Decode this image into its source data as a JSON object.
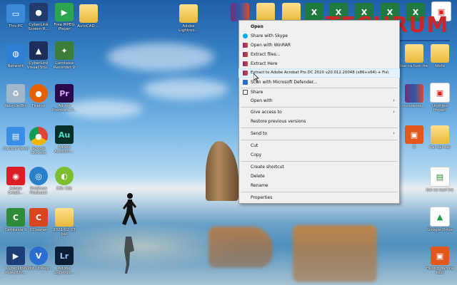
{
  "logo": {
    "text": "TECHRUM"
  },
  "desktop_icons": {
    "thispc": "This PC",
    "screen_recorder": "CyberLink Screen R...",
    "mpeg": "Free MPEG Player",
    "autocad": "AutoCAD ...",
    "adobe_lightroom_top": "Adobe Lightroo...",
    "network": "Network",
    "visual_studio": "CyberLink Visual Stu...",
    "camtasia_recorder": "Camtasia Recorder 9",
    "recycle_bin": "Recycle Bin",
    "firefox": "Firefox",
    "premiere": "Adobe Premiere P...",
    "control_panel": "Control Panel",
    "chrome": "Google Chrome",
    "audition": "Adobe Audition...",
    "adobe_creative": "Adobe Creati...",
    "proshow": "ProShow Producer",
    "coc_coc": "Cốc Cốc",
    "camtasia9": "Camtasia 9",
    "ccleaner": "CCleaner",
    "folder_2021": "2021 02 03 bài",
    "powerdirector": "CyberLink PowerDir...",
    "vidio": "Vidio Unikey...",
    "lightroom_bottom": "Adobe Lightroo...",
    "bai_ca_tuoi_tre": "bai ca tuoi tre",
    "fdsfd": "fdsfd",
    "mouse_rec": "mouserec...",
    "untitled_project": "Untitled Project",
    "r_file": "R",
    "cai_dat_bai": "Cai dat bai",
    "bai_ca_tuoi_tre_2": "bai ca tuoi tre",
    "google_drive": "Google Drive",
    "huong_dan": "Huong dan ca tuoi"
  },
  "context_menu": {
    "items": [
      "Open",
      "Share with Skype",
      "Open with WinRAR",
      "Extract files...",
      "Extract Here",
      "Extract to Adobe Acrobat Pro DC 2020 v20.012.20048 (x86+x64) + Fix\\",
      "Scan with Microsoft Defender...",
      "Share",
      "Open with",
      "Give access to",
      "Restore previous versions",
      "Send to",
      "Cut",
      "Copy",
      "Create shortcut",
      "Delete",
      "Rename",
      "Properties"
    ]
  },
  "colors": {
    "menu_bg": "#f0f0f0",
    "hover": "#e5f1fb",
    "logo_red": "#c9262a",
    "logo_blue": "#1f4f9a"
  },
  "icons": [
    "winrar-icon",
    "skype-icon",
    "defender-icon",
    "share-icon"
  ]
}
